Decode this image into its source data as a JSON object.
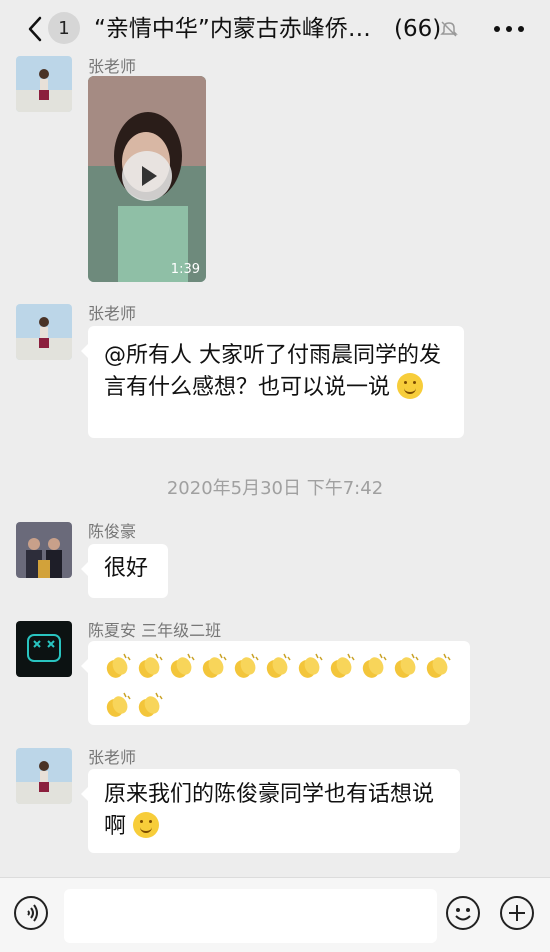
{
  "header": {
    "unread_badge": "1",
    "title": "“亲情中华”内蒙古赤峰侨…",
    "member_count": "(66)",
    "icons": [
      "back-icon",
      "mute-bell-icon",
      "more-icon"
    ]
  },
  "messages": [
    {
      "sender": "张老师",
      "type": "video",
      "duration": "1:39"
    },
    {
      "sender": "张老师",
      "type": "text",
      "text": "@所有人 大家听了付雨晨同学的发言有什么感想？也可以说一说"
    },
    {
      "sender": "陈俊豪",
      "type": "text",
      "text": "很好"
    },
    {
      "sender": "陈夏安  三年级二班",
      "type": "claps",
      "count": 13
    },
    {
      "sender": "张老师",
      "type": "text",
      "text": "原来我们的陈俊豪同学也有话想说啊"
    }
  ],
  "timestamp": "2020年5月30日 下午7:42",
  "input": {
    "placeholder": ""
  },
  "colors": {
    "background": "#ededed",
    "bubble": "#ffffff",
    "emoji_yellow": "#f7cd3a"
  }
}
